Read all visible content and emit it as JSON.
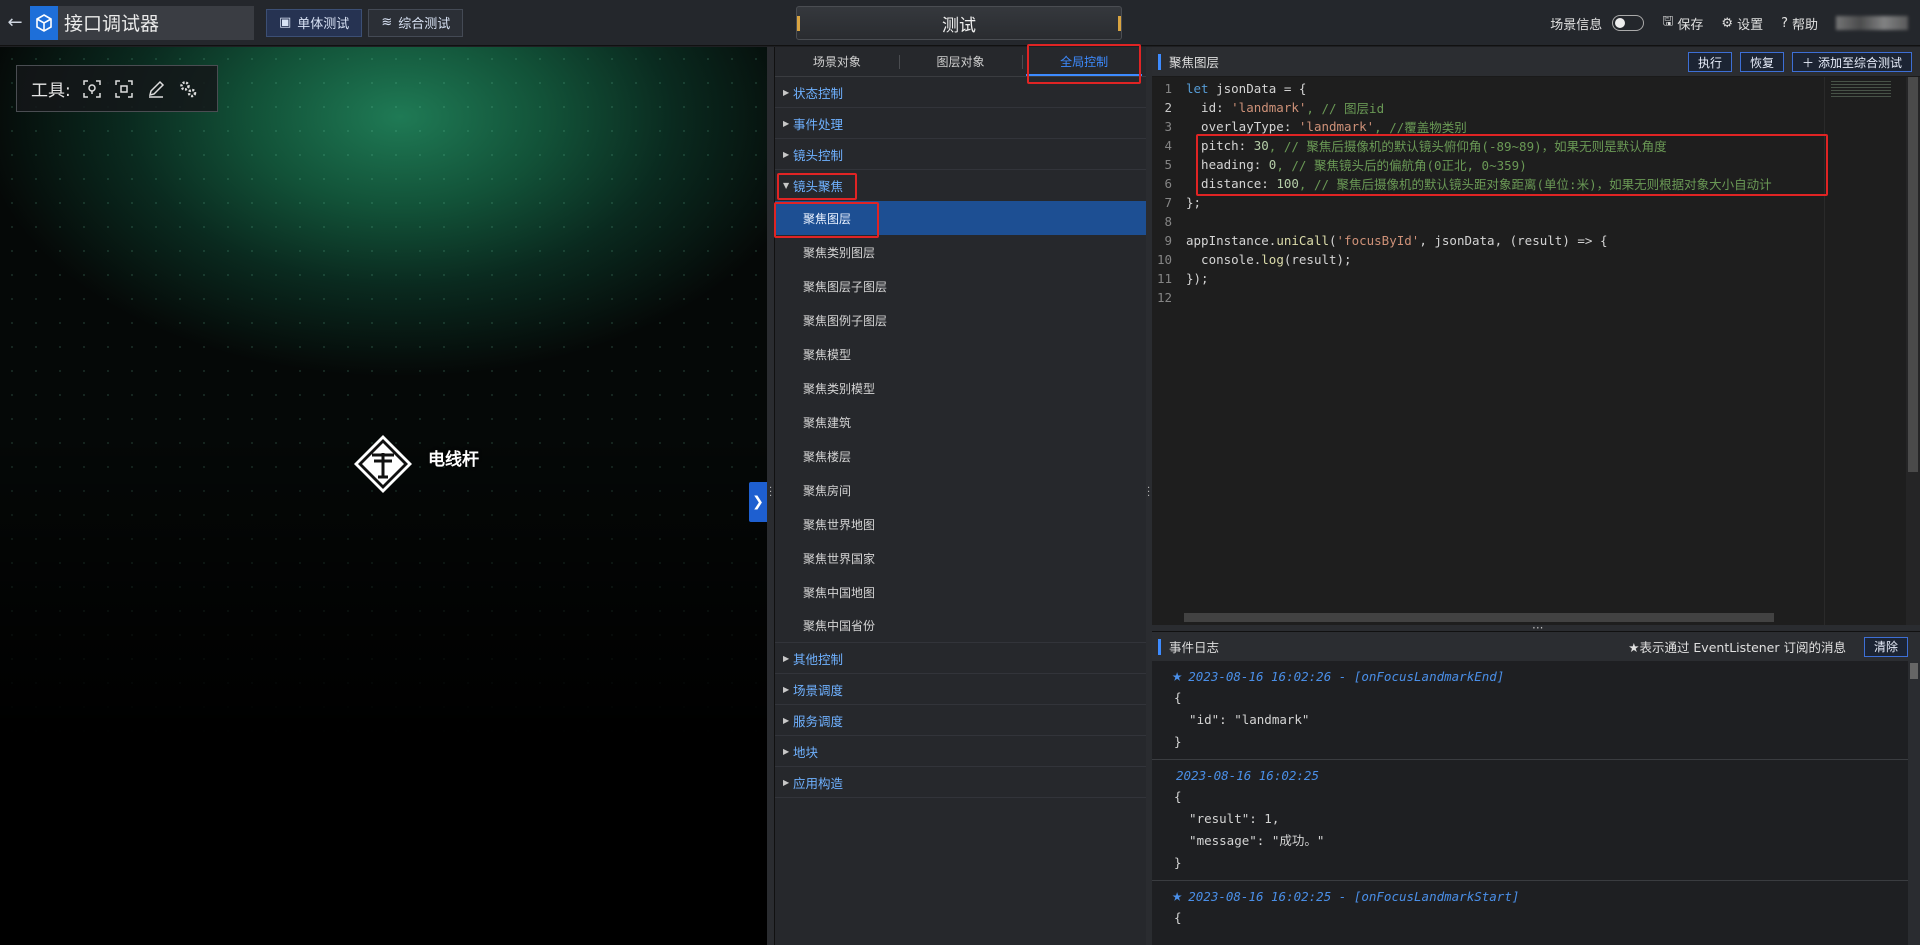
{
  "header": {
    "back_icon": "arrow-left-icon",
    "app_title": "接口调试器",
    "mode_single": "单体测试",
    "mode_combined": "综合测试",
    "center_title": "测试",
    "scene_info_label": "场景信息",
    "save_label": "保存",
    "settings_label": "设置",
    "help_label": "帮助"
  },
  "scene": {
    "tools_label": "工具:",
    "marker_label": "电线杆",
    "collapse_icon": "chevron-right-icon"
  },
  "tree": {
    "tabs": [
      "场景对象",
      "图层对象",
      "全局控制"
    ],
    "active_tab": "全局控制",
    "groups_before": [
      "状态控制",
      "事件处理",
      "镜头控制"
    ],
    "expanded_group": "镜头聚焦",
    "children": [
      "聚焦图层",
      "聚焦类别图层",
      "聚焦图层子图层",
      "聚焦图例子图层",
      "聚焦模型",
      "聚焦类别模型",
      "聚焦建筑",
      "聚焦楼层",
      "聚焦房间",
      "聚焦世界地图",
      "聚焦世界国家",
      "聚焦中国地图",
      "聚焦中国省份"
    ],
    "selected_child": "聚焦图层",
    "groups_after": [
      "其他控制",
      "场景调度",
      "服务调度",
      "地块",
      "应用构造"
    ]
  },
  "editor": {
    "title": "聚焦图层",
    "run_label": "执行",
    "reset_label": "恢复",
    "add_label": "添加至综合测试",
    "line_numbers": [
      "1",
      "2",
      "3",
      "4",
      "5",
      "6",
      "7",
      "8",
      "9",
      "10",
      "11",
      "12"
    ],
    "code": {
      "l1_kw": "let",
      "l1_rest": " jsonData = {",
      "l2_key": "  id: ",
      "l2_str": "'landmark'",
      "l2_cmt": ", // 图层id",
      "l3_key": "  overlayType: ",
      "l3_str": "'landmark'",
      "l3_cmt": ", //覆盖物类别",
      "l4_key": "  pitch: ",
      "l4_num": "30",
      "l4_cmt": ", // 聚焦后摄像机的默认镜头俯仰角(-89~89)，如果无则是默认角度",
      "l5_key": "  heading: ",
      "l5_num": "0",
      "l5_cmt": ", // 聚焦镜头后的偏航角(0正北, 0~359)",
      "l6_key": "  distance: ",
      "l6_num": "100",
      "l6_cmt": ", // 聚焦后摄像机的默认镜头距对象距离(单位:米)，如果无则根据对象大小自动计",
      "l7": "};",
      "l9_a": "appInstance.",
      "l9_fn": "uniCall",
      "l9_b": "(",
      "l9_str": "'focusById'",
      "l9_c": ", jsonData, (result) => {",
      "l10_a": "  console.",
      "l10_fn": "log",
      "l10_b": "(result);",
      "l11": "});"
    }
  },
  "log": {
    "title": "事件日志",
    "note": "★表示通过 EventListener 订阅的消息",
    "clear_label": "清除",
    "entries": [
      {
        "head": "2023-08-16 16:02:26 - [onFocusLandmarkEnd]",
        "starred": true,
        "l1": "{",
        "l2": "  \"id\": \"landmark\"",
        "l3": "}"
      },
      {
        "head": "2023-08-16 16:02:25",
        "starred": false,
        "l1": "{",
        "l2": "  \"result\": 1,",
        "l3": "  \"message\": \"成功。\"",
        "l4": "}"
      },
      {
        "head": "2023-08-16 16:02:25 - [onFocusLandmarkStart]",
        "starred": true,
        "l1": "{"
      }
    ]
  }
}
